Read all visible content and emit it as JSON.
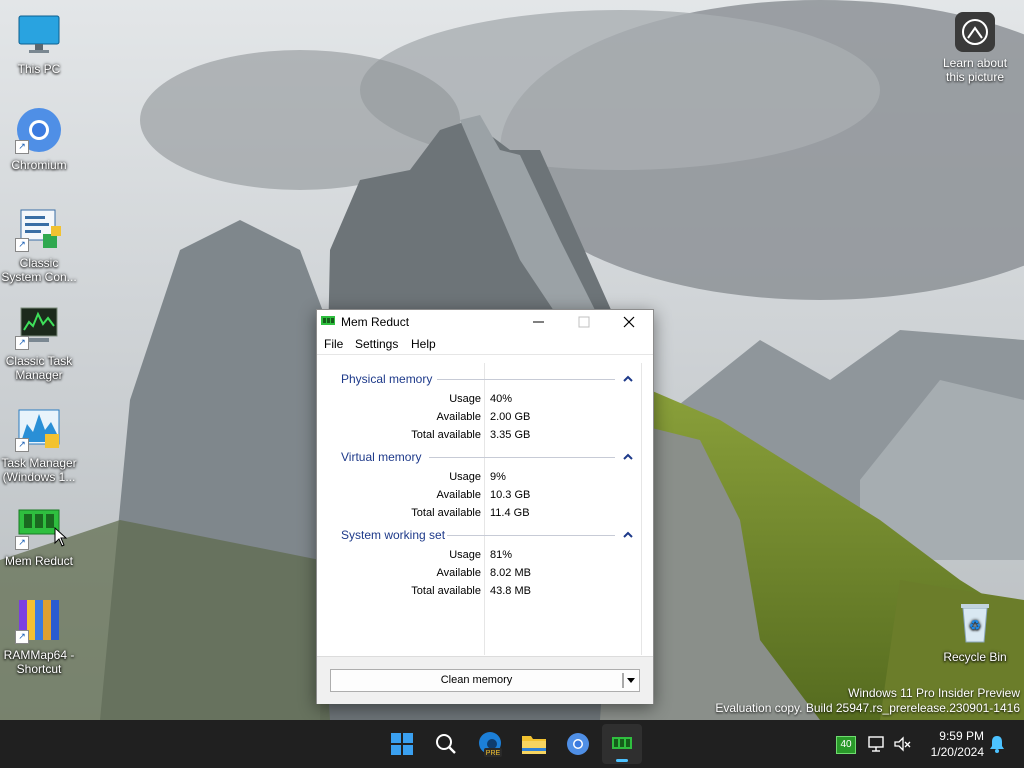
{
  "desktop": {
    "icons": [
      {
        "label": "This PC"
      },
      {
        "label": "Chromium"
      },
      {
        "label": "Classic System Con..."
      },
      {
        "label": "Classic Task Manager"
      },
      {
        "label": "Task Manager (Windows 1..."
      },
      {
        "label": "Mem Reduct"
      },
      {
        "label": "RAMMap64 - Shortcut"
      }
    ],
    "learn_label": "Learn about this picture",
    "recycle_label": "Recycle Bin",
    "watermark": {
      "line1": "Windows 11 Pro Insider Preview",
      "line2": "Evaluation copy. Build 25947.rs_prerelease.230901-1416"
    }
  },
  "window": {
    "title": "Mem Reduct",
    "menu": [
      "File",
      "Settings",
      "Help"
    ],
    "groups": [
      {
        "name": "Physical memory",
        "rows": [
          {
            "label": "Usage",
            "value": "40%"
          },
          {
            "label": "Available",
            "value": "2.00 GB"
          },
          {
            "label": "Total available",
            "value": "3.35 GB"
          }
        ]
      },
      {
        "name": "Virtual memory",
        "rows": [
          {
            "label": "Usage",
            "value": "9%"
          },
          {
            "label": "Available",
            "value": "10.3 GB"
          },
          {
            "label": "Total available",
            "value": "11.4 GB"
          }
        ]
      },
      {
        "name": "System working set",
        "rows": [
          {
            "label": "Usage",
            "value": "81%"
          },
          {
            "label": "Available",
            "value": "8.02 MB"
          },
          {
            "label": "Total available",
            "value": "43.8 MB"
          }
        ]
      }
    ],
    "clean_button": "Clean memory"
  },
  "taskbar": {
    "tray_badge": "40",
    "time": "9:59 PM",
    "date": "1/20/2024",
    "edge_badge": "PRE"
  },
  "colors": {
    "accent": "#4cc2ff",
    "group_header": "#1e3a8a",
    "taskbar": "#202020"
  }
}
